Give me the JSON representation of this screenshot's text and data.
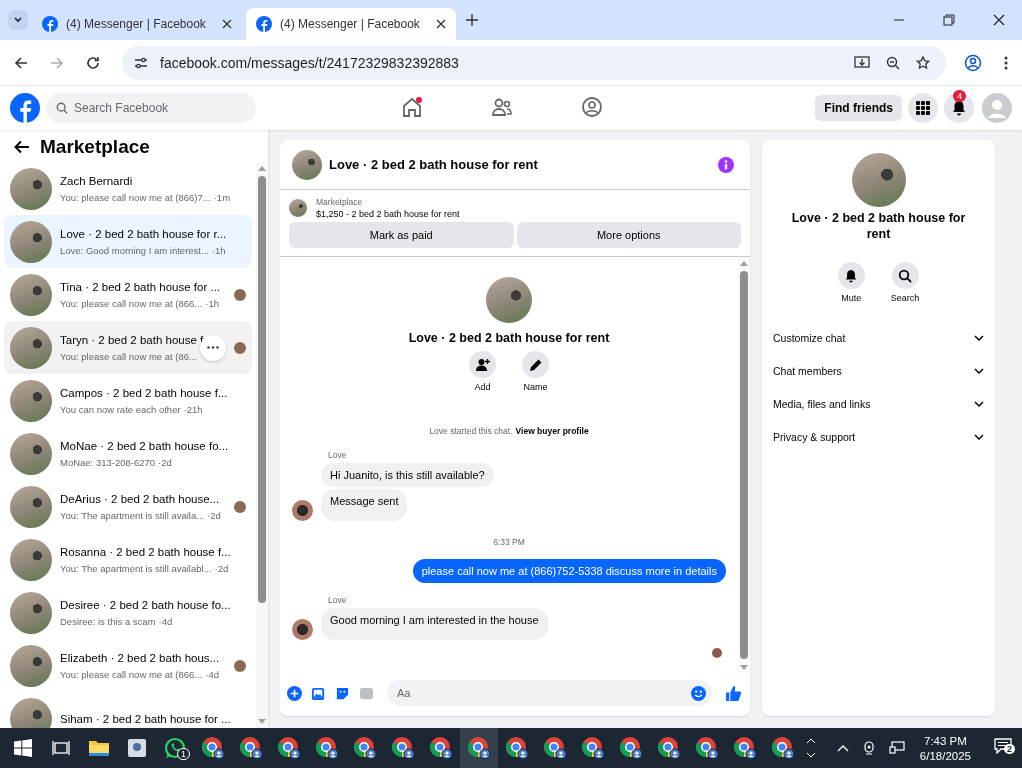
{
  "browser": {
    "tabs": [
      {
        "title": "(4) Messenger | Facebook",
        "selected": false
      },
      {
        "title": "(4) Messenger | Facebook",
        "selected": true
      }
    ],
    "url": "facebook.com/messages/t/24172329832392883"
  },
  "topbar": {
    "search_placeholder": "Search Facebook",
    "nav": [
      {
        "kind": "home",
        "selected": false,
        "dot": true
      },
      {
        "kind": "friends",
        "selected": false,
        "dot": false
      },
      {
        "kind": "groups",
        "selected": false,
        "dot": false
      }
    ],
    "find_friends": "Find friends",
    "notification_count": "4"
  },
  "sidebar": {
    "title": "Marketplace",
    "conversations": [
      {
        "name": "Zach Bernardi",
        "preview": "You: please call now me at (866)7...",
        "time": "·1m",
        "selected": false,
        "hovered": false,
        "seen_avatar": false
      },
      {
        "name": "Love · 2 bed 2 bath house for r...",
        "preview": "Love: Good morning I am interest...",
        "time": "·1h",
        "selected": true,
        "hovered": false,
        "seen_avatar": false
      },
      {
        "name": "Tina · 2 bed 2 bath house for ...",
        "preview": "You: please call now me at (866...",
        "time": "·1h",
        "selected": false,
        "hovered": false,
        "seen_avatar": true
      },
      {
        "name": "Taryn · 2 bed 2 bath house f",
        "preview": "You: please call now me at (86...",
        "selected": false,
        "hovered": true,
        "seen_avatar": true
      },
      {
        "name": "Campos · 2 bed 2 bath house f...",
        "preview": "You can now rate each other",
        "time": "·21h",
        "selected": false,
        "hovered": false,
        "seen_avatar": false
      },
      {
        "name": "MoNae · 2 bed 2 bath house fo...",
        "preview": "MoNae: 313-208-6270",
        "time": "·2d",
        "selected": false,
        "hovered": false,
        "seen_avatar": false
      },
      {
        "name": "DeArius · 2 bed 2 bath house...",
        "preview": "You: The apartment is still availa...",
        "time": "·2d",
        "selected": false,
        "hovered": false,
        "seen_avatar": true
      },
      {
        "name": "Rosanna · 2 bed 2 bath house f...",
        "preview": "You: The apartment is still availabl...",
        "time": "·2d",
        "selected": false,
        "hovered": false,
        "seen_avatar": false
      },
      {
        "name": "Desiree · 2 bed 2 bath house fo...",
        "preview": "Desiree: is this a scam",
        "time": "·4d",
        "selected": false,
        "hovered": false,
        "seen_avatar": false
      },
      {
        "name": "Elizabeth · 2 bed 2 bath hous...",
        "preview": "You: please call now me at (866...",
        "time": "·4d",
        "selected": false,
        "hovered": false,
        "seen_avatar": true
      },
      {
        "name": "Siham · 2 bed 2 bath house for ...",
        "selected": false,
        "hovered": false,
        "seen_avatar": false
      }
    ]
  },
  "chat": {
    "title": "Love · 2 bed 2 bath house for rent",
    "listing_label": "Marketplace",
    "listing": "$1,250 - 2 bed 2 bath house for rent",
    "buttons": [
      "Mark as paid",
      "More options"
    ],
    "intro_title": "Love · 2 bed 2 bath house for rent",
    "intro_actions": [
      {
        "kind": "add",
        "label": "Add"
      },
      {
        "kind": "name",
        "label": "Name"
      }
    ],
    "notice": "Love started this chat.",
    "notice_link": "View buyer profile",
    "messages": [
      {
        "kind": "incoming",
        "sender": "Love",
        "text": "Hi Juanito, is this still available?",
        "avatar": false
      },
      {
        "kind": "incoming",
        "text": "Message sent",
        "avatar": true
      },
      {
        "kind": "timestamp",
        "text": "6:33 PM"
      },
      {
        "kind": "outgoing",
        "text": "please call now me at (866)752-5338 discuss more in details"
      },
      {
        "kind": "incoming",
        "sender": "Love",
        "text": "Good morning  I am interested in the house",
        "avatar": true
      }
    ],
    "composer_placeholder": "Aa"
  },
  "details": {
    "title": "Love · 2 bed 2 bath house for rent",
    "actions": [
      {
        "kind": "mute",
        "label": "Mute"
      },
      {
        "kind": "search",
        "label": "Search"
      }
    ],
    "sections": [
      {
        "label": "Customize chat",
        "expanded": false
      },
      {
        "label": "Chat members",
        "expanded": false
      },
      {
        "label": "Media, files and links",
        "expanded": false
      },
      {
        "label": "Privacy & support",
        "expanded": false
      }
    ]
  },
  "taskbar": {
    "apps": [
      {
        "kind": "taskview",
        "selected": false
      },
      {
        "kind": "folder",
        "selected": false
      },
      {
        "kind": "app",
        "selected": false
      },
      {
        "kind": "whatsapp",
        "selected": false,
        "badge": "1"
      },
      {
        "kind": "chrome",
        "selected": false
      },
      {
        "kind": "chrome",
        "selected": false
      },
      {
        "kind": "chrome",
        "selected": false
      },
      {
        "kind": "chrome",
        "selected": false
      },
      {
        "kind": "chrome",
        "selected": false
      },
      {
        "kind": "chrome",
        "selected": false
      },
      {
        "kind": "chrome",
        "selected": false
      },
      {
        "kind": "chrome",
        "selected": true
      },
      {
        "kind": "chrome",
        "selected": false
      },
      {
        "kind": "chrome",
        "selected": false
      },
      {
        "kind": "chrome",
        "selected": false
      },
      {
        "kind": "chrome",
        "selected": false
      },
      {
        "kind": "chrome",
        "selected": false
      },
      {
        "kind": "chrome",
        "selected": false
      },
      {
        "kind": "chrome",
        "selected": false
      },
      {
        "kind": "chrome",
        "selected": false
      }
    ],
    "time": "7:43 PM",
    "date": "6/18/2025",
    "notification_count": "2"
  }
}
